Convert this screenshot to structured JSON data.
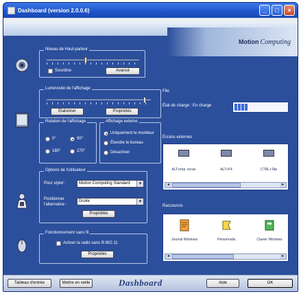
{
  "window": {
    "title": "Dashboard (version 2.0.0.6)",
    "minimize_glyph": "_",
    "maximize_glyph": "□",
    "close_glyph": "×"
  },
  "logo": {
    "brand": "Motion",
    "product": "Computing"
  },
  "groups": {
    "audio": {
      "label": "Niveau de Haut-parleur",
      "mute_label": "Sourdine",
      "advanced_button": "Avancé"
    },
    "display": {
      "label": "Luminosité de l'affichage",
      "left_button": "Étalonner",
      "right_button": "Propriétés"
    },
    "orientation": {
      "label": "Rotation de l'affichage",
      "options": [
        "0°",
        "90°",
        "180°",
        "270°"
      ]
    },
    "display_mode": {
      "label": "Affichage externe",
      "options": [
        "Uniquement le moniteur",
        "Étendre le bureau",
        "Désactiver"
      ]
    },
    "pen": {
      "label": "Options de l'utilisateur",
      "profile_label": "Pour stylet :",
      "profile_value": "Motion Computing Standard",
      "alignment_label": "Positionner l'alternative :",
      "alignment_value": "Droite",
      "properties_button": "Propriétés"
    },
    "power": {
      "label": "Fonctionnement sans fil",
      "checkbox_label": "Activer la radio sans fil 802.11",
      "properties_button": "Propriétés"
    }
  },
  "right": {
    "file_label": "File",
    "charge_label": "État de charge : En charge",
    "devices_label": "Écrans externes",
    "devices": [
      {
        "label": "ALT+imp. écran"
      },
      {
        "label": "ALT+F4"
      },
      {
        "label": "CTRL+Tab"
      }
    ],
    "shortcuts_label": "Raccourcis",
    "shortcuts": [
      {
        "label": "Journal Windows"
      },
      {
        "label": "Personnalis."
      },
      {
        "label": "Clavier Windows"
      }
    ]
  },
  "bottom": {
    "left_button": "Tableau d'entrée",
    "middle_button": "Mettre en veille",
    "brand": "Dashboard",
    "help_button": "Aide",
    "ok_button": "OK"
  },
  "levels": {
    "speaker_volume_fraction": 0.42,
    "brightness_fraction": 0.95,
    "battery_fraction": 0.25
  },
  "colors": {
    "window_bg": "#2c4f9c",
    "titlebar": "#1f54c8",
    "panel_bg": "#ffffff",
    "accent": "#1a3a90"
  }
}
